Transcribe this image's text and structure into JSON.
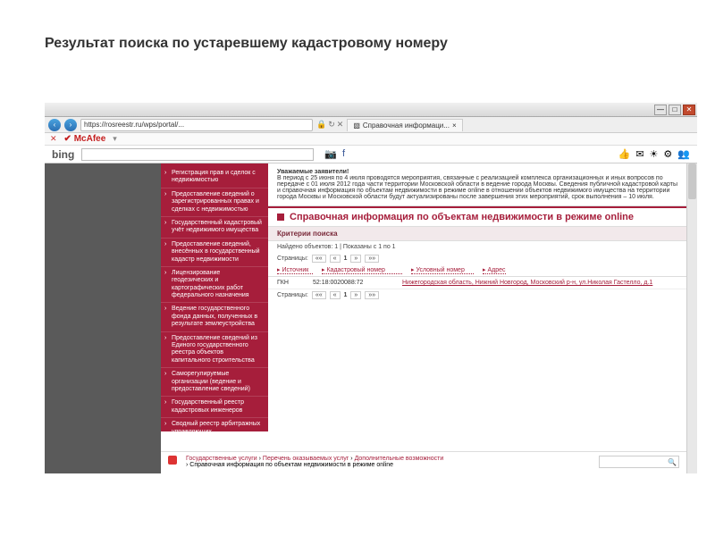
{
  "slide": {
    "title": "Результат поиска по устаревшему кадастровому номеру"
  },
  "browser": {
    "url": "https://rosreestr.ru/wps/portal/...",
    "tab_title": "Справочная информаци...",
    "mcafee": "McAfee",
    "bing": "bing"
  },
  "sidebar": {
    "items": [
      "Регистрация прав и сделок с недвижимостью",
      "Предоставление сведений о зарегистрированных правах и сделках с недвижимостью",
      "Государственный кадастровый учёт недвижимого имущества",
      "Предоставление сведений, внесённых в государственный кадастр недвижимости",
      "Лицензирование геодезических и картографических работ федерального назначения",
      "Ведение государственного фонда данных, полученных в результате землеустройства",
      "Предоставление сведений из Единого государственного реестра объектов капитального строительства",
      "Саморегулируемые организации (ведение и предоставление сведений)",
      "Государственный реестр кадастровых инженеров",
      "Сводный реестр арбитражных управляющих"
    ]
  },
  "notice": {
    "greeting": "Уважаемые заявители!",
    "text": "В период с 25 июня по 4 июля проводятся мероприятия, связанные с реализацией комплекса организационных и иных вопросов по передаче с 01 июля 2012 года части территории Московской области в ведение города Москвы. Сведения публичной кадастровой карты и справочная информация по объектам недвижимости в режиме online в отношении объектов недвижимого имущества на территории города Москвы и Московской области будут актуализированы после завершения этих мероприятий, срок выполнения – 10 июля."
  },
  "section": {
    "title": "Справочная информация по объектам недвижимости в режиме online"
  },
  "criteria_label": "Критерии поиска",
  "result_count": "Найдено объектов: 1 | Показаны с 1 по 1",
  "pager": {
    "label": "Страницы:",
    "current": "1"
  },
  "table": {
    "headers": {
      "source": "Источник",
      "cadnum": "Кадастровый номер",
      "cond": "Условный номер",
      "addr": "Адрес"
    },
    "row": {
      "source": "ГКН",
      "cadnum": "52:18:0020088:72",
      "address": "Нижегородская область, Нижний Новгород, Московский р-н, ул.Николая Гастелло, д.1"
    }
  },
  "breadcrumb": {
    "links": [
      "Государственные услуги",
      "Перечень оказываемых услуг",
      "Дополнительные возможности"
    ],
    "current": "Справочная информация по объектам недвижимости в режиме online",
    "search_placeholder": "Поиск"
  }
}
